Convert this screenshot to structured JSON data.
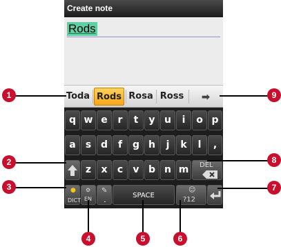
{
  "title_bar": {
    "title": "Create note"
  },
  "note": {
    "text": "Rods"
  },
  "suggestions": {
    "items": [
      "Toda",
      "Rods",
      "Rosa",
      "Ross"
    ],
    "active_index": 1,
    "more_icon": "right-arrow-icon"
  },
  "keyboard": {
    "row1": [
      "q",
      "w",
      "e",
      "r",
      "t",
      "y",
      "u",
      "i",
      "o",
      "p"
    ],
    "row2": [
      "a",
      "s",
      "d",
      "f",
      "g",
      "h",
      "j",
      "k",
      "l",
      ","
    ],
    "row3": [
      "z",
      "x",
      "c",
      "v",
      "b",
      "n",
      "m"
    ],
    "shift_icon": "shift-arrow-icon",
    "del_label": "DEL",
    "dict_label": "DICT",
    "lang_label": "EN",
    "period_label": ".",
    "space_label": "SPACE",
    "symbols_label": "?12",
    "enter_icon": "enter-arrow-icon"
  },
  "callouts": [
    "1",
    "2",
    "3",
    "4",
    "5",
    "6",
    "7",
    "8",
    "9"
  ],
  "colors": {
    "active_suggestion": "#f5a51a",
    "callout": "#c8102e",
    "keyboard_bg": "#1d1d1d"
  }
}
